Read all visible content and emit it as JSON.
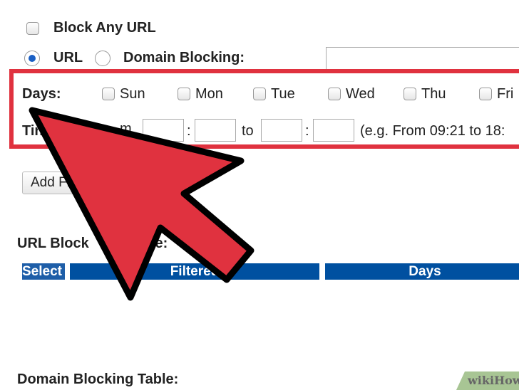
{
  "block_any_url": "Block Any URL",
  "mode": {
    "url": "URL",
    "domain": "Domain Blocking:",
    "selected": "URL"
  },
  "days": {
    "label": "Days:",
    "items": [
      "Sun",
      "Mon",
      "Tue",
      "Wed",
      "Thu",
      "Fri"
    ]
  },
  "time": {
    "label": "Tin",
    "from": "m",
    "colon": ":",
    "to": "to",
    "example": "(e.g. From 09:21 to 18:"
  },
  "add_button": "Add Fi",
  "url_table": {
    "title_a": "URL Block",
    "title_b": "le:",
    "headers": [
      "Select",
      "Filtered",
      "Days"
    ]
  },
  "domain_table": {
    "title": "Domain Blocking Table:"
  },
  "watermark": "wikiHow",
  "colors": {
    "highlight": "#e0323f",
    "header": "#0050a0"
  }
}
